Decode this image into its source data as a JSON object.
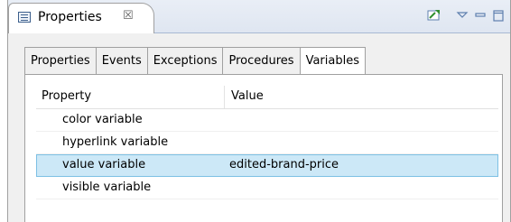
{
  "view": {
    "tab_title": "Properties",
    "tab_close_glyph": "☒"
  },
  "toolbar": {
    "icons": [
      "pin-icon",
      "view-menu-icon",
      "minimize-icon",
      "maximize-icon"
    ]
  },
  "tabs": [
    {
      "label": "Properties",
      "active": false
    },
    {
      "label": "Events",
      "active": false
    },
    {
      "label": "Exceptions",
      "active": false
    },
    {
      "label": "Procedures",
      "active": false
    },
    {
      "label": "Variables",
      "active": true
    }
  ],
  "table": {
    "headers": {
      "property": "Property",
      "value": "Value"
    },
    "rows": [
      {
        "property": "color variable",
        "value": ""
      },
      {
        "property": "hyperlink variable",
        "value": ""
      },
      {
        "property": "value variable",
        "value": "edited-brand-price",
        "selected": true
      },
      {
        "property": "visible variable",
        "value": ""
      }
    ]
  },
  "colors": {
    "selection": "#cce8f7",
    "selection_border": "#7dc0e4",
    "header_gradient": "#e4eaf4"
  }
}
